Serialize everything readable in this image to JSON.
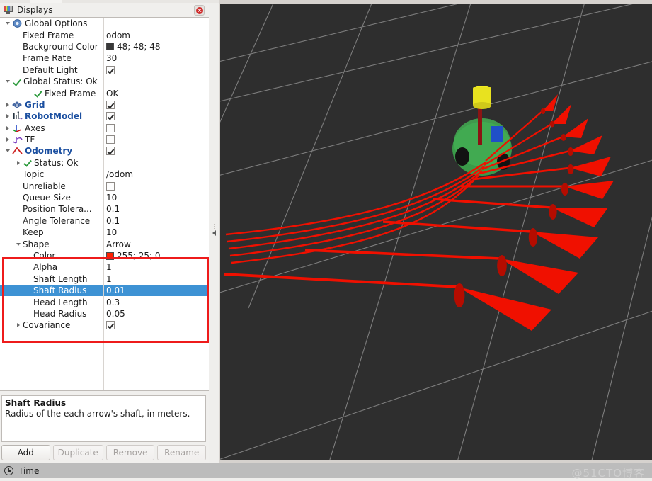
{
  "panel": {
    "title": "Displays",
    "icon": "monitor-icon",
    "close_icon": "close-icon"
  },
  "tree": {
    "rows": [
      {
        "id": "global-options",
        "depth": 0,
        "arrow": "open",
        "icon": "gear-icon",
        "label": "Global Options",
        "style": "plain",
        "value_type": "none"
      },
      {
        "id": "fixed-frame",
        "depth": 1,
        "arrow": "none",
        "icon": "none",
        "label": "Fixed Frame",
        "style": "plain",
        "value_type": "text",
        "value": "odom"
      },
      {
        "id": "background-color",
        "depth": 1,
        "arrow": "none",
        "icon": "none",
        "label": "Background Color",
        "style": "plain",
        "value_type": "color",
        "value": "48; 48; 48",
        "swatch": "#383838"
      },
      {
        "id": "frame-rate",
        "depth": 1,
        "arrow": "none",
        "icon": "none",
        "label": "Frame Rate",
        "style": "plain",
        "value_type": "text",
        "value": "30"
      },
      {
        "id": "default-light",
        "depth": 1,
        "arrow": "none",
        "icon": "none",
        "label": "Default Light",
        "style": "plain",
        "value_type": "checkbox",
        "checked": true
      },
      {
        "id": "global-status",
        "depth": 0,
        "arrow": "open",
        "icon": "check-icon",
        "label": "Global Status: Ok",
        "style": "plain",
        "value_type": "none"
      },
      {
        "id": "status-fixed-frame",
        "depth": 2,
        "arrow": "none",
        "icon": "check-icon",
        "label": "Fixed Frame",
        "style": "plain",
        "value_type": "text",
        "value": "OK"
      },
      {
        "id": "grid",
        "depth": 0,
        "arrow": "closed",
        "icon": "grid-icon",
        "label": "Grid",
        "style": "link",
        "value_type": "checkbox",
        "checked": true
      },
      {
        "id": "robot-model",
        "depth": 0,
        "arrow": "closed",
        "icon": "robot-icon",
        "label": "RobotModel",
        "style": "link",
        "value_type": "checkbox",
        "checked": true
      },
      {
        "id": "axes",
        "depth": 0,
        "arrow": "closed",
        "icon": "axes-icon",
        "label": "Axes",
        "style": "plain",
        "value_type": "checkbox",
        "checked": false
      },
      {
        "id": "tf",
        "depth": 0,
        "arrow": "closed",
        "icon": "tf-icon",
        "label": "TF",
        "style": "plain",
        "value_type": "checkbox",
        "checked": false
      },
      {
        "id": "odometry",
        "depth": 0,
        "arrow": "open",
        "icon": "odom-icon",
        "label": "Odometry",
        "style": "link",
        "value_type": "checkbox",
        "checked": true
      },
      {
        "id": "odom-status",
        "depth": 1,
        "arrow": "closed",
        "icon": "check-icon",
        "label": "Status: Ok",
        "style": "plain",
        "value_type": "none"
      },
      {
        "id": "topic",
        "depth": 1,
        "arrow": "none",
        "icon": "none",
        "label": "Topic",
        "style": "plain",
        "value_type": "text",
        "value": "/odom"
      },
      {
        "id": "unreliable",
        "depth": 1,
        "arrow": "none",
        "icon": "none",
        "label": "Unreliable",
        "style": "plain",
        "value_type": "checkbox",
        "checked": false
      },
      {
        "id": "queue-size",
        "depth": 1,
        "arrow": "none",
        "icon": "none",
        "label": "Queue Size",
        "style": "plain",
        "value_type": "text",
        "value": "10"
      },
      {
        "id": "position-tolerance",
        "depth": 1,
        "arrow": "none",
        "icon": "none",
        "label": "Position Tolera...",
        "style": "plain",
        "value_type": "text",
        "value": "0.1"
      },
      {
        "id": "angle-tolerance",
        "depth": 1,
        "arrow": "none",
        "icon": "none",
        "label": "Angle Tolerance",
        "style": "plain",
        "value_type": "text",
        "value": "0.1"
      },
      {
        "id": "keep",
        "depth": 1,
        "arrow": "none",
        "icon": "none",
        "label": "Keep",
        "style": "plain",
        "value_type": "text",
        "value": "10"
      },
      {
        "id": "shape",
        "depth": 1,
        "arrow": "open",
        "icon": "none",
        "label": "Shape",
        "style": "plain",
        "value_type": "text",
        "value": "Arrow"
      },
      {
        "id": "color",
        "depth": 2,
        "arrow": "none",
        "icon": "none",
        "label": "Color",
        "style": "plain",
        "value_type": "color",
        "value": "255; 25; 0",
        "swatch": "#fc2200"
      },
      {
        "id": "alpha",
        "depth": 2,
        "arrow": "none",
        "icon": "none",
        "label": "Alpha",
        "style": "plain",
        "value_type": "text",
        "value": "1"
      },
      {
        "id": "shaft-length",
        "depth": 2,
        "arrow": "none",
        "icon": "none",
        "label": "Shaft Length",
        "style": "plain",
        "value_type": "text",
        "value": "1"
      },
      {
        "id": "shaft-radius",
        "depth": 2,
        "arrow": "none",
        "icon": "none",
        "label": "Shaft Radius",
        "style": "plain",
        "value_type": "text",
        "value": "0.01",
        "selected": true
      },
      {
        "id": "head-length",
        "depth": 2,
        "arrow": "none",
        "icon": "none",
        "label": "Head Length",
        "style": "plain",
        "value_type": "text",
        "value": "0.3"
      },
      {
        "id": "head-radius",
        "depth": 2,
        "arrow": "none",
        "icon": "none",
        "label": "Head Radius",
        "style": "plain",
        "value_type": "text",
        "value": "0.05"
      },
      {
        "id": "covariance",
        "depth": 1,
        "arrow": "closed",
        "icon": "none",
        "label": "Covariance",
        "style": "plain",
        "value_type": "checkbox",
        "checked": true
      }
    ]
  },
  "annotation": {
    "color": "#ee1b1b",
    "highlights": [
      "shape",
      "color",
      "alpha",
      "shaft-length",
      "shaft-radius",
      "head-length",
      "head-radius"
    ]
  },
  "description": {
    "title": "Shaft Radius",
    "text": "Radius of the each arrow's shaft, in meters."
  },
  "buttons": [
    {
      "id": "add",
      "label": "Add",
      "enabled": true
    },
    {
      "id": "duplicate",
      "label": "Duplicate",
      "enabled": false
    },
    {
      "id": "remove",
      "label": "Remove",
      "enabled": false
    },
    {
      "id": "rename",
      "label": "Rename",
      "enabled": false
    }
  ],
  "time_bar": {
    "label": "Time",
    "icon": "clock-icon"
  },
  "render_view": {
    "background_color": "#2e2e2e",
    "grid_color": "#9a9a9a",
    "arrow_color": "#f01000",
    "robot_body_color": "#3aa34a",
    "robot_top_color": "#e6e000",
    "robot_marker_color": "#2050c8",
    "arrow_count": 10
  },
  "watermark": "@51CTO博客"
}
